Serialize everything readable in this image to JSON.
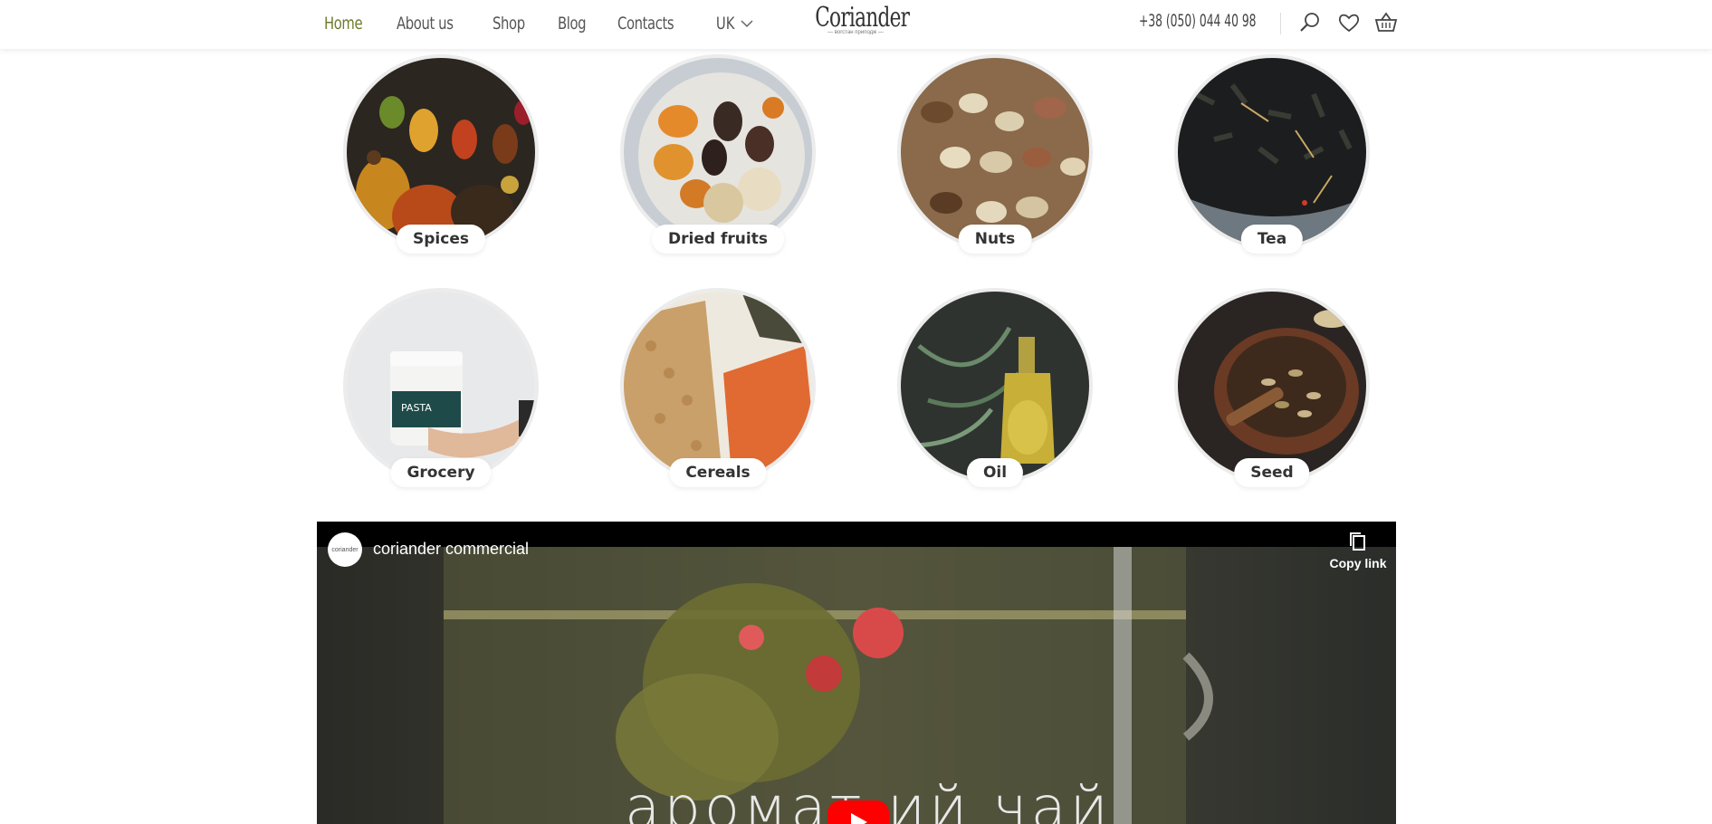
{
  "header": {
    "nav": [
      {
        "label": "Home",
        "active": true
      },
      {
        "label": "About us",
        "active": false
      },
      {
        "label": "Shop",
        "active": false
      },
      {
        "label": "Blog",
        "active": false
      },
      {
        "label": "Contacts",
        "active": false
      }
    ],
    "language": "UK",
    "logo": {
      "name": "Coriander",
      "tagline": "— вогстан приподж —"
    },
    "phone": "+38 (050) 044 40 98",
    "icons": [
      "search-icon",
      "heart-icon",
      "basket-icon"
    ]
  },
  "categories": [
    {
      "label": "Spices"
    },
    {
      "label": "Dried fruits"
    },
    {
      "label": "Nuts"
    },
    {
      "label": "Tea"
    },
    {
      "label": "Grocery"
    },
    {
      "label": "Cereals"
    },
    {
      "label": "Oil"
    },
    {
      "label": "Seed"
    }
  ],
  "video": {
    "channel_avatar_text": "coriander",
    "title": "coriander commercial",
    "copy_link": "Copy link",
    "caption": "аромат ий чай"
  },
  "colors": {
    "accent": "#6f7a2c",
    "play": "#ff0000"
  }
}
